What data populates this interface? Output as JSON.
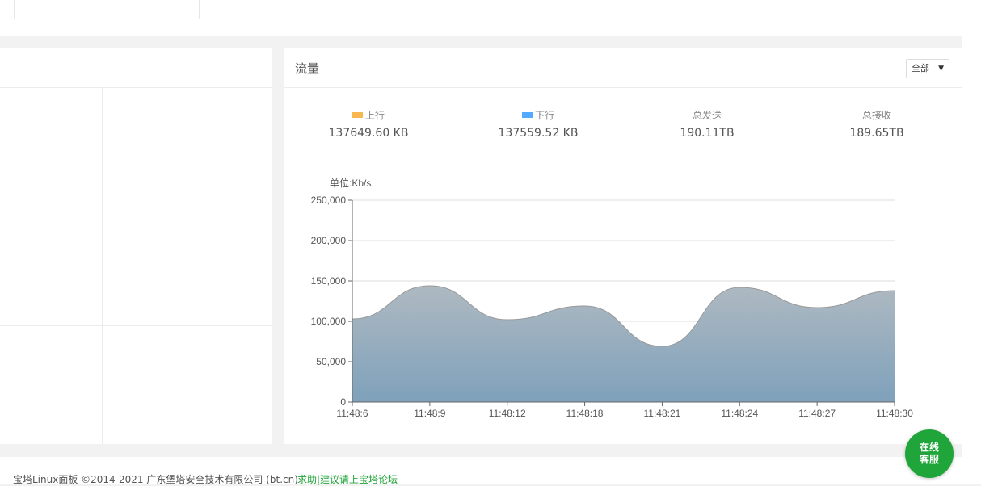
{
  "traffic": {
    "title": "流量",
    "range_select": "全部",
    "stats": [
      {
        "label": "上行",
        "value": "137649.60 KB",
        "color": "#f7b851"
      },
      {
        "label": "下行",
        "value": "137559.52 KB",
        "color": "#52a9ff"
      },
      {
        "label": "总发送",
        "value": "190.11TB"
      },
      {
        "label": "总接收",
        "value": "189.65TB"
      }
    ]
  },
  "chart_data": {
    "type": "area",
    "ylabel": "单位:Kb/s",
    "x": [
      "11:48:6",
      "11:48:9",
      "11:48:12",
      "11:48:18",
      "11:48:21",
      "11:48:24",
      "11:48:27",
      "11:48:30"
    ],
    "series": [
      {
        "values": [
          103000,
          144000,
          102000,
          119000,
          69000,
          142000,
          117000,
          138000
        ]
      }
    ],
    "yticks": [
      "0",
      "50,000",
      "100,000",
      "150,000",
      "200,000",
      "250,000"
    ],
    "ylim": [
      0,
      250000
    ],
    "grid": true,
    "colors": {
      "fill_top": "#aeb9c1",
      "fill_bottom": "#7fa1bb",
      "line": "#999999"
    }
  },
  "footer": {
    "copyright": "宝塔Linux面板 ©2014-2021 广东堡塔安全技术有限公司 (bt.cn)",
    "forum_link": "求助|建议请上宝塔论坛"
  },
  "support": {
    "line1": "在线",
    "line2": "客服"
  }
}
